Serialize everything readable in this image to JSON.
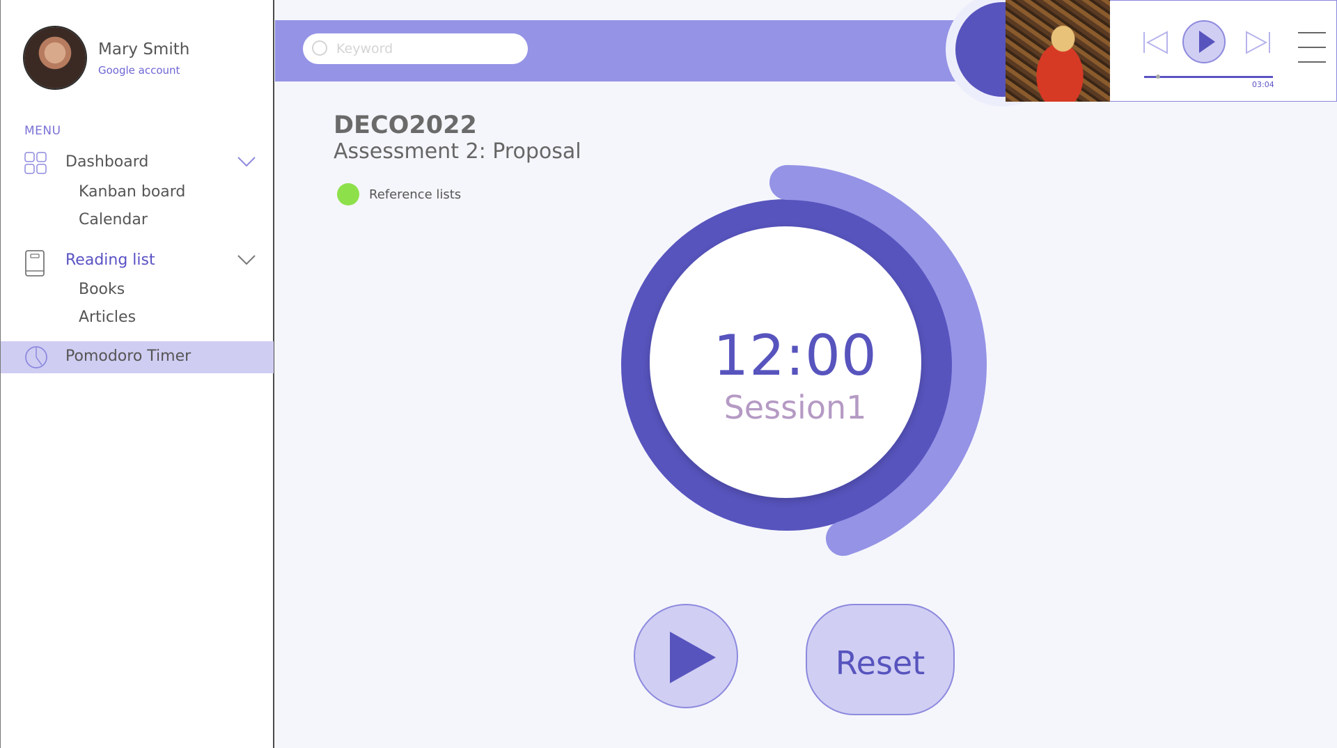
{
  "user": {
    "name": "Mary Smith",
    "account": "Google account"
  },
  "sidebar": {
    "menu_label": "MENU",
    "dashboard": {
      "label": "Dashboard",
      "icon": "grid-icon",
      "sub": [
        "Kanban board",
        "Calendar"
      ]
    },
    "reading": {
      "label": "Reading list",
      "icon": "book-icon",
      "sub": [
        "Books",
        "Articles"
      ]
    },
    "pomodoro": {
      "label": "Pomodoro Timer",
      "icon": "clock-icon"
    }
  },
  "search": {
    "placeholder": "Keyword"
  },
  "player": {
    "time": "03:04",
    "progress_fraction": 0.1
  },
  "main": {
    "course": "DECO2022",
    "assessment": "Assessment 2: Proposal",
    "reference": "Reference lists",
    "timer": "12:00",
    "session": "Session1",
    "reset_label": "Reset",
    "remaining_fraction": 0.45
  },
  "colors": {
    "accent": "#5754be",
    "accent_light": "#9593e6",
    "button_bg": "#d0cef3",
    "status_green": "#8ee04b"
  }
}
